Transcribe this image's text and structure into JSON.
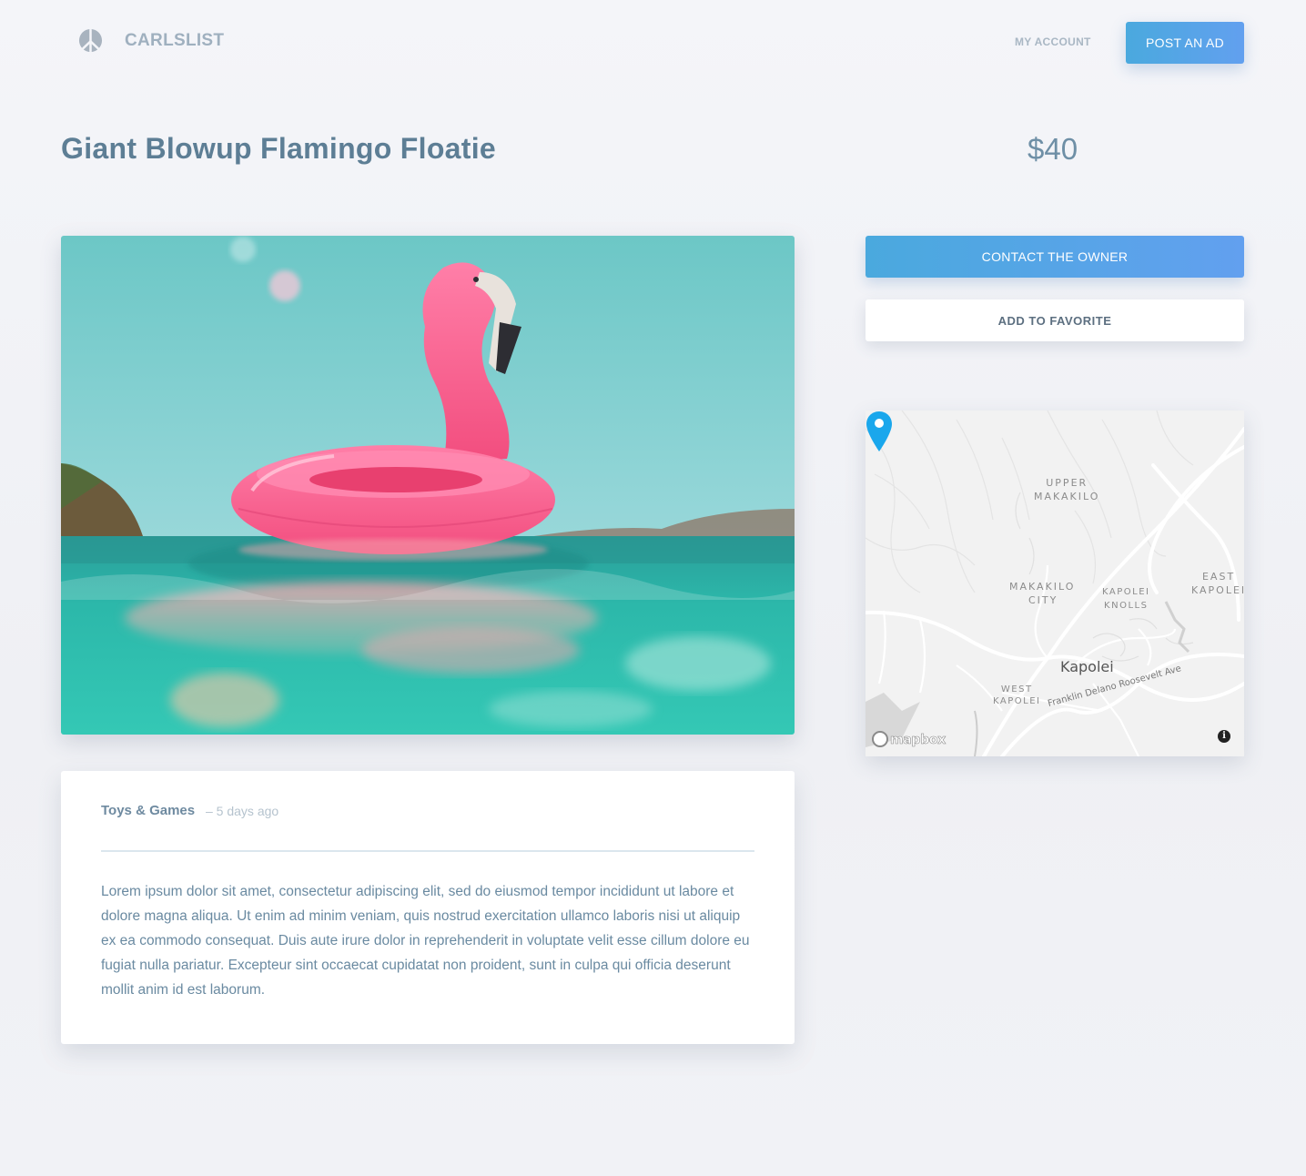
{
  "header": {
    "brand": "CARLSLIST",
    "logo_icon": "peace-sign-icon",
    "nav_account": "MY ACCOUNT",
    "post_ad_label": "POST AN AD"
  },
  "listing": {
    "title": "Giant Blowup Flamingo Floatie",
    "price": "$40",
    "photo_icon": "flamingo-float-photo",
    "category": "Toys & Games",
    "posted": "– 5 days ago",
    "description": "Lorem ipsum dolor sit amet, consectetur adipiscing elit, sed do eiusmod tempor incididunt ut labore et dolore magna aliqua. Ut enim ad minim veniam, quis nostrud exercitation ullamco laboris nisi ut aliquip ex ea commodo consequat. Duis aute irure dolor in reprehenderit in voluptate velit esse cillum dolore eu fugiat nulla pariatur. Excepteur sint occaecat cupidatat non proident, sunt in culpa qui officia deserunt mollit anim id est laborum."
  },
  "actions": {
    "contact_label": "CONTACT THE OWNER",
    "favorite_label": "ADD TO FAVORITE"
  },
  "map": {
    "labels": {
      "upper_makakilo_1": "UPPER",
      "upper_makakilo_2": "MAKAKILO",
      "makakilo_city_1": "MAKAKILO",
      "makakilo_city_2": "CITY",
      "kapolei_knolls_1": "KAPOLEI",
      "kapolei_knolls_2": "KNOLLS",
      "east_kapolei_1": "EAST",
      "east_kapolei_2": "KAPOLEI",
      "west_kapolei_1": "WEST",
      "west_kapolei_2": "KAPOLEI",
      "city": "Kapolei",
      "road": "Franklin Delano Roosevelt Ave"
    },
    "attribution": "mapbox",
    "info_glyph": "i",
    "pin_color": "#1aa7ec"
  },
  "colors": {
    "accent_start": "#4aa9de",
    "accent_end": "#62a0ef",
    "title": "#5d7e95"
  }
}
